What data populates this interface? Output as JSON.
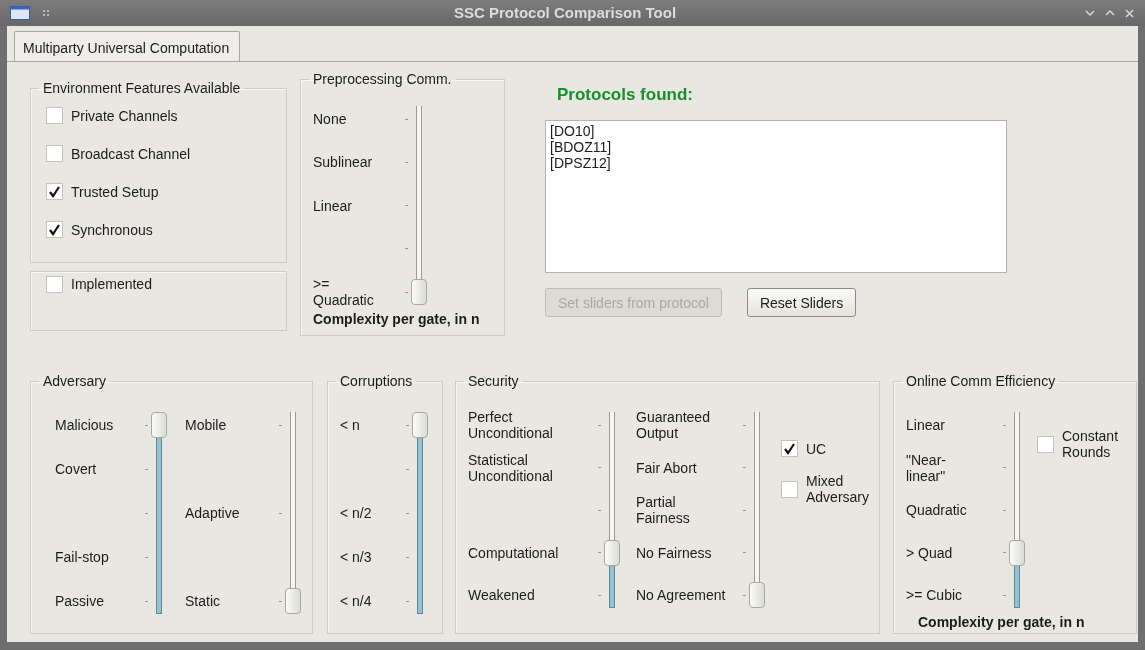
{
  "window": {
    "title": "SSC Protocol Comparison Tool"
  },
  "tabs": [
    {
      "label": "Multiparty Universal Computation",
      "selected": true
    }
  ],
  "environment": {
    "title": "Environment Features Available",
    "options": [
      {
        "label": "Private Channels",
        "checked": false
      },
      {
        "label": "Broadcast Channel",
        "checked": false
      },
      {
        "label": "Trusted Setup",
        "checked": true
      },
      {
        "label": "Synchronous",
        "checked": true
      }
    ]
  },
  "implemented": {
    "label": "Implemented",
    "checked": false
  },
  "preprocessing": {
    "title": "Preprocessing Comm.",
    "slider": {
      "level": 0,
      "stops": [
        {
          "kind": "label",
          "label": "None"
        },
        {
          "kind": "label",
          "label": "Sublinear"
        },
        {
          "kind": "label",
          "label": "Linear"
        },
        {
          "kind": "tick"
        },
        {
          "kind": "label",
          "label": ">=\nQuadratic"
        }
      ]
    },
    "caption": "Complexity per gate, in n"
  },
  "results": {
    "heading": "Protocols found:",
    "protocols": [
      "[DO10]",
      "[BDOZ11]",
      "[DPSZ12]"
    ],
    "buttons": [
      {
        "label": "Set sliders from protocol",
        "disabled": true
      },
      {
        "label": "Reset Sliders",
        "disabled": false
      }
    ]
  },
  "adversary": {
    "title": "Adversary",
    "sliders": [
      {
        "level": 1,
        "stops": [
          {
            "kind": "label",
            "label": "Malicious"
          },
          {
            "kind": "label",
            "label": "Covert"
          },
          {
            "kind": "tick"
          },
          {
            "kind": "label",
            "label": "Fail-stop"
          },
          {
            "kind": "label",
            "label": "Passive"
          }
        ]
      },
      {
        "level": 0,
        "stops": [
          {
            "kind": "label",
            "label": "Mobile"
          },
          {
            "kind": "label",
            "label": "Adaptive"
          },
          {
            "kind": "label",
            "label": "Static"
          }
        ]
      }
    ]
  },
  "corruptions": {
    "title": "Corruptions",
    "slider": {
      "level": 1,
      "stops": [
        {
          "kind": "label",
          "label": "< n"
        },
        {
          "kind": "tick"
        },
        {
          "kind": "label",
          "label": "< n/2"
        },
        {
          "kind": "label",
          "label": "< n/3"
        },
        {
          "kind": "label",
          "label": "< n/4"
        }
      ]
    }
  },
  "security": {
    "title": "Security",
    "sliders": [
      {
        "level": 0.25,
        "stops": [
          {
            "kind": "label",
            "label": "Perfect\nUnconditional"
          },
          {
            "kind": "label",
            "label": "Statistical\nUnconditional"
          },
          {
            "kind": "tick"
          },
          {
            "kind": "label",
            "label": "Computational"
          },
          {
            "kind": "label",
            "label": "Weakened"
          }
        ]
      },
      {
        "level": 0,
        "stops": [
          {
            "kind": "label",
            "label": "Guaranteed\nOutput"
          },
          {
            "kind": "label",
            "label": "Fair Abort"
          },
          {
            "kind": "label",
            "label": "Partial\nFairness"
          },
          {
            "kind": "label",
            "label": "No Fairness"
          },
          {
            "kind": "label",
            "label": "No Agreement"
          }
        ]
      }
    ],
    "options": [
      {
        "label": "UC",
        "checked": true
      },
      {
        "label": "Mixed\nAdversary",
        "checked": false
      }
    ]
  },
  "online": {
    "title": "Online Comm Efficiency",
    "slider": {
      "level": 0.25,
      "stops": [
        {
          "kind": "label",
          "label": "Linear"
        },
        {
          "kind": "label",
          "label": "\"Near-\nlinear\""
        },
        {
          "kind": "label",
          "label": "Quadratic"
        },
        {
          "kind": "label",
          "label": "> Quad"
        },
        {
          "kind": "label",
          "label": ">= Cubic"
        }
      ]
    },
    "options": [
      {
        "label": "Constant\nRounds",
        "checked": false
      }
    ],
    "caption": "Complexity per gate, in n"
  }
}
